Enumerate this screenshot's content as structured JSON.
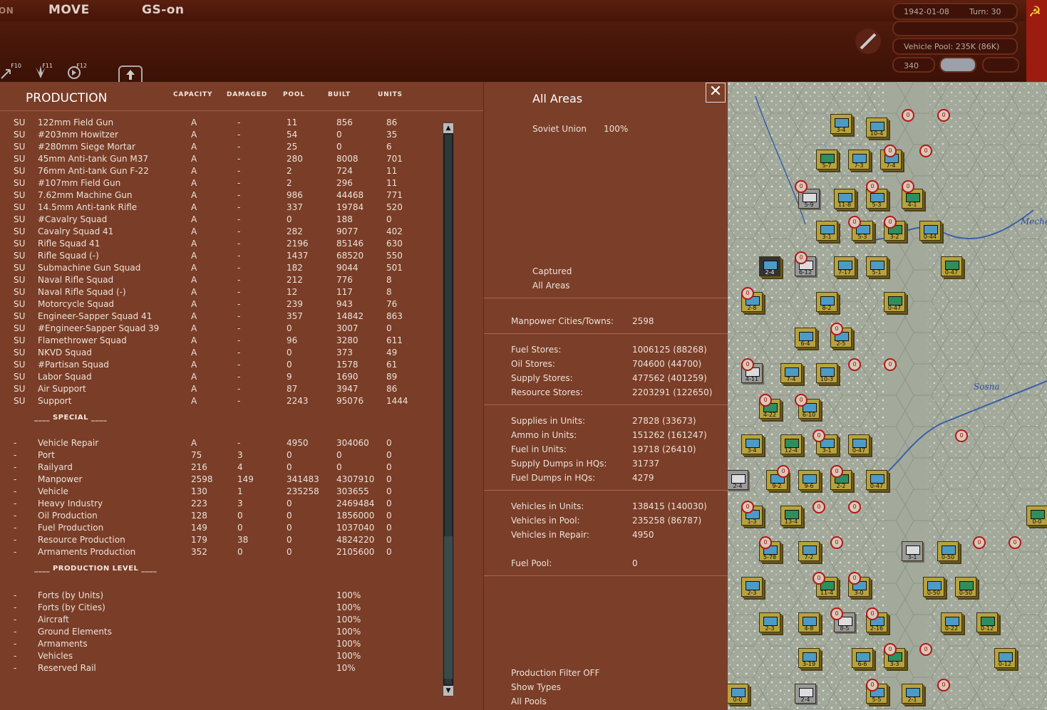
{
  "topbar": {
    "tab_left": "ON",
    "tab_move": "MOVE",
    "tab_gs": "GS-on"
  },
  "hotkeys": [
    {
      "label": "F10"
    },
    {
      "label": "F11"
    },
    {
      "label": "F12"
    }
  ],
  "info": {
    "date": "1942-01-08",
    "turn": "Turn: 30",
    "vehicle_pool": "Vehicle Pool: 235K (86K)",
    "num": "340"
  },
  "production": {
    "title": "PRODUCTION",
    "columns": [
      "CAPACITY",
      "DAMAGED",
      "POOL",
      "BUILT",
      "UNITS"
    ],
    "rows": [
      [
        "SU",
        "122mm Field Gun",
        "A",
        "-",
        "11",
        "856",
        "86"
      ],
      [
        "SU",
        "#203mm Howitzer",
        "A",
        "-",
        "54",
        "0",
        "35"
      ],
      [
        "SU",
        "#280mm Siege Mortar",
        "A",
        "-",
        "25",
        "0",
        "6"
      ],
      [
        "SU",
        "45mm Anti-tank Gun M37",
        "A",
        "-",
        "280",
        "8008",
        "701"
      ],
      [
        "SU",
        "76mm Anti-tank Gun F-22",
        "A",
        "-",
        "2",
        "724",
        "11"
      ],
      [
        "SU",
        "#107mm Field Gun",
        "A",
        "-",
        "2",
        "296",
        "11"
      ],
      [
        "SU",
        "7.62mm Machine Gun",
        "A",
        "-",
        "986",
        "44468",
        "771"
      ],
      [
        "SU",
        "14.5mm Anti-tank Rifle",
        "A",
        "-",
        "337",
        "19784",
        "520"
      ],
      [
        "SU",
        "#Cavalry Squad",
        "A",
        "-",
        "0",
        "188",
        "0"
      ],
      [
        "SU",
        "Cavalry Squad 41",
        "A",
        "-",
        "282",
        "9077",
        "402"
      ],
      [
        "SU",
        "Rifle Squad 41",
        "A",
        "-",
        "2196",
        "85146",
        "630"
      ],
      [
        "SU",
        "Rifle Squad (-)",
        "A",
        "-",
        "1437",
        "68520",
        "550"
      ],
      [
        "SU",
        "Submachine Gun Squad",
        "A",
        "-",
        "182",
        "9044",
        "501"
      ],
      [
        "SU",
        "Naval Rifle Squad",
        "A",
        "-",
        "212",
        "776",
        "8"
      ],
      [
        "SU",
        "Naval Rifle Squad (-)",
        "A",
        "-",
        "12",
        "117",
        "8"
      ],
      [
        "SU",
        "Motorcycle Squad",
        "A",
        "-",
        "239",
        "943",
        "76"
      ],
      [
        "SU",
        "Engineer-Sapper Squad 41",
        "A",
        "-",
        "357",
        "14842",
        "863"
      ],
      [
        "SU",
        "#Engineer-Sapper Squad 39",
        "A",
        "-",
        "0",
        "3007",
        "0"
      ],
      [
        "SU",
        "Flamethrower Squad",
        "A",
        "-",
        "96",
        "3280",
        "611"
      ],
      [
        "SU",
        "NKVD Squad",
        "A",
        "-",
        "0",
        "373",
        "49"
      ],
      [
        "SU",
        "#Partisan Squad",
        "A",
        "-",
        "0",
        "1578",
        "61"
      ],
      [
        "SU",
        "Labor Squad",
        "A",
        "-",
        "9",
        "1690",
        "89"
      ],
      [
        "SU",
        "Air Support",
        "A",
        "-",
        "87",
        "3947",
        "86"
      ],
      [
        "SU",
        "Support",
        "A",
        "-",
        "2243",
        "95076",
        "1444"
      ]
    ],
    "special_title": "____ SPECIAL ____",
    "special": [
      [
        "-",
        "Vehicle Repair",
        "A",
        "-",
        "4950",
        "304060",
        "0"
      ],
      [
        "-",
        "Port",
        "75",
        "3",
        "0",
        "0",
        "0"
      ],
      [
        "-",
        "Railyard",
        "216",
        "4",
        "0",
        "0",
        "0"
      ],
      [
        "-",
        "Manpower",
        "2598",
        "149",
        "341483",
        "4307910",
        "0"
      ],
      [
        "-",
        "Vehicle",
        "130",
        "1",
        "235258",
        "303655",
        "0"
      ],
      [
        "-",
        "Heavy Industry",
        "223",
        "3",
        "0",
        "2469484",
        "0"
      ],
      [
        "-",
        "Oil Production",
        "128",
        "0",
        "0",
        "1856000",
        "0"
      ],
      [
        "-",
        "Fuel Production",
        "149",
        "0",
        "0",
        "1037040",
        "0"
      ],
      [
        "-",
        "Resource Production",
        "179",
        "38",
        "0",
        "4824220",
        "0"
      ],
      [
        "-",
        "Armaments Production",
        "352",
        "0",
        "0",
        "2105600",
        "0"
      ]
    ],
    "level_title": "____ PRODUCTION LEVEL ____",
    "levels": [
      [
        "-",
        "Forts (by Units)",
        "100%"
      ],
      [
        "-",
        "Forts (by Cities)",
        "100%"
      ],
      [
        "-",
        "Aircraft",
        "100%"
      ],
      [
        "-",
        "Ground Elements",
        "100%"
      ],
      [
        "-",
        "Armaments",
        "100%"
      ],
      [
        "-",
        "Vehicles",
        "100%"
      ],
      [
        "-",
        "Reserved Rail",
        "10%"
      ]
    ]
  },
  "stats": {
    "close": "✕",
    "title": "All Areas",
    "country": "Soviet Union",
    "country_pct": "100%",
    "captured": "Captured",
    "captured_all": "All Areas",
    "manpower": {
      "label": "Manpower Cities/Towns:",
      "value": "2598"
    },
    "stores": [
      {
        "label": "Fuel Stores:",
        "value": "1006125 (88268)"
      },
      {
        "label": "Oil Stores:",
        "value": "704600 (44700)"
      },
      {
        "label": "Supply Stores:",
        "value": "477562 (401259)"
      },
      {
        "label": "Resource Stores:",
        "value": "2203291 (122650)"
      }
    ],
    "supplies": [
      {
        "label": "Supplies in Units:",
        "value": "27828 (33673)"
      },
      {
        "label": "Ammo in Units:",
        "value": "151262 (161247)"
      },
      {
        "label": "Fuel in Units:",
        "value": "19718 (26410)"
      },
      {
        "label": "Supply Dumps in HQs:",
        "value": "31737"
      },
      {
        "label": "Fuel Dumps in HQs:",
        "value": "4279"
      }
    ],
    "vehicles": [
      {
        "label": "Vehicles in Units:",
        "value": "138415 (140030)"
      },
      {
        "label": "Vehicles in Pool:",
        "value": "235258 (86787)"
      },
      {
        "label": "Vehicles in Repair:",
        "value": "4950"
      }
    ],
    "fuel_pool": {
      "label": "Fuel Pool:",
      "value": "0"
    },
    "filter": "Production Filter OFF",
    "show_types": "Show Types",
    "all_pools": "All Pools"
  },
  "map": {
    "labels": {
      "river1": "Sosna",
      "river2": "Meche"
    },
    "counters": [
      {
        "t": "3-4"
      },
      {
        "t": "10-4"
      },
      {
        "t": "5-7"
      },
      {
        "t": "7-3"
      },
      {
        "t": "7-4"
      },
      {
        "t": "5-9"
      },
      {
        "t": "11-8"
      },
      {
        "t": "5-3"
      },
      {
        "t": "4-1"
      },
      {
        "t": "3-1"
      },
      {
        "t": "5-3"
      },
      {
        "t": "3-2"
      },
      {
        "t": "0-44"
      },
      {
        "t": "2-4"
      },
      {
        "t": "6-12"
      },
      {
        "t": "7-17"
      },
      {
        "t": "5-1"
      },
      {
        "t": "0-47"
      },
      {
        "t": "2-8"
      },
      {
        "t": "8-2"
      },
      {
        "t": "0-47"
      },
      {
        "t": "6-4"
      },
      {
        "t": "2-5"
      },
      {
        "t": "4-11"
      },
      {
        "t": "7-4"
      },
      {
        "t": "10-3"
      },
      {
        "t": "4-22"
      },
      {
        "t": "6-10"
      },
      {
        "t": "3-4"
      },
      {
        "t": "12-4"
      },
      {
        "t": "3-1"
      },
      {
        "t": "0-47"
      },
      {
        "t": "2-4"
      },
      {
        "t": "9-2"
      },
      {
        "t": "9-6"
      },
      {
        "t": "2-2"
      },
      {
        "t": "0-47"
      },
      {
        "t": "1-3"
      },
      {
        "t": "13-4"
      },
      {
        "t": "5-78"
      },
      {
        "t": "7-2"
      },
      {
        "t": "3-1"
      },
      {
        "t": "0-50"
      },
      {
        "t": "2-3"
      },
      {
        "t": "11-4"
      },
      {
        "t": "3-0"
      },
      {
        "t": "0-50"
      },
      {
        "t": "0-50"
      },
      {
        "t": "2-3"
      },
      {
        "t": "4-8"
      },
      {
        "t": "8-5"
      },
      {
        "t": "2-16"
      },
      {
        "t": "0-22"
      },
      {
        "t": "0-12"
      },
      {
        "t": "3-19"
      },
      {
        "t": "6-6"
      },
      {
        "t": "3-3"
      },
      {
        "t": "0-12"
      },
      {
        "t": "0-0"
      },
      {
        "t": "2-4"
      },
      {
        "t": "5-5"
      },
      {
        "t": "2-1"
      },
      {
        "t": "0-0"
      }
    ]
  }
}
